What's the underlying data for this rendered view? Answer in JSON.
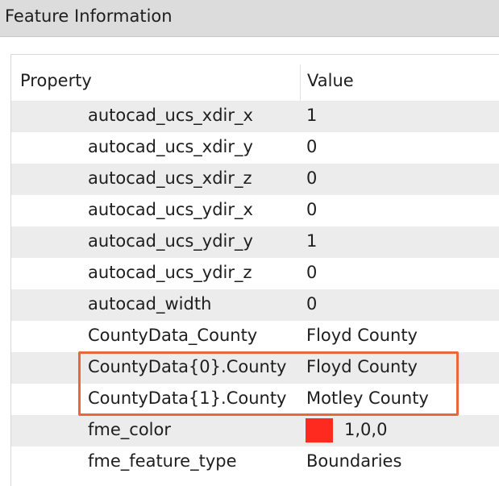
{
  "window": {
    "title": "Feature Information"
  },
  "table": {
    "headers": {
      "property": "Property",
      "value": "Value"
    },
    "rows": [
      {
        "property": "autocad_ucs_xdir_x",
        "value": "1"
      },
      {
        "property": "autocad_ucs_xdir_y",
        "value": "0"
      },
      {
        "property": "autocad_ucs_xdir_z",
        "value": "0"
      },
      {
        "property": "autocad_ucs_ydir_x",
        "value": "0"
      },
      {
        "property": "autocad_ucs_ydir_y",
        "value": "1"
      },
      {
        "property": "autocad_ucs_ydir_z",
        "value": "0"
      },
      {
        "property": "autocad_width",
        "value": "0"
      },
      {
        "property": "CountyData_County",
        "value": "Floyd County"
      },
      {
        "property": "CountyData{0}.County",
        "value": "Floyd County"
      },
      {
        "property": "CountyData{1}.County",
        "value": "Motley County"
      },
      {
        "property": "fme_color",
        "value": "1,0,0",
        "swatch_color": "#ff2a1f"
      },
      {
        "property": "fme_feature_type",
        "value": "Boundaries"
      }
    ]
  },
  "colors": {
    "highlight_border": "#e8683c",
    "row_shade": "#ececec",
    "title_bar": "#dcdcdc"
  }
}
